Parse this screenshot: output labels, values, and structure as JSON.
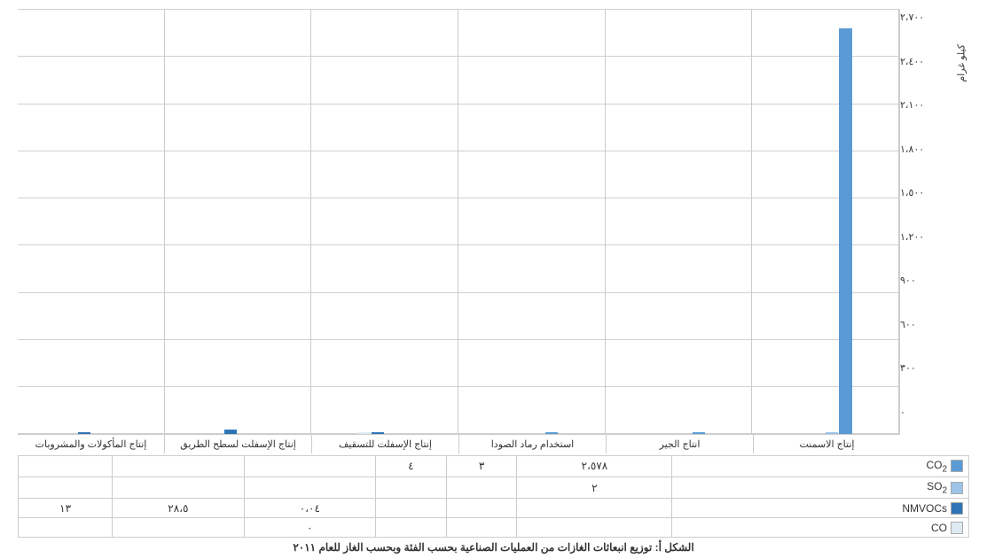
{
  "chart": {
    "title": "الشكل أ: توزيع انبعاثات الغازات من العملیات الصناعیة بحسب الفئة وبحسب الغاز للعام ٢٠١١",
    "y_axis_title": "كيلو غرام",
    "y_labels": [
      "٢،٧٠٠",
      "٢،٤٠٠",
      "٢،١٠٠",
      "١،٨٠٠",
      "١،٥٠٠",
      "١،٢٠٠",
      "٩٠٠",
      "٦٠٠",
      "٣٠٠",
      "٠"
    ],
    "y_max": 2700,
    "categories": [
      {
        "id": "cement",
        "label": "إنتاج الاسمنت"
      },
      {
        "id": "lime",
        "label": "انتاج الجیر"
      },
      {
        "id": "soda_ash",
        "label": "استخدام رماد الصودا"
      },
      {
        "id": "asphalt_roof",
        "label": "إنتاج الإسفلت للتسقیف"
      },
      {
        "id": "asphalt_road",
        "label": "إنتاج الإسفلت لسطح الطریق"
      },
      {
        "id": "food",
        "label": "إنتاج المأكولات والمشروبات"
      }
    ],
    "gases": [
      {
        "id": "co2",
        "label": "CO₂",
        "color": "#5b9bd5",
        "values": {
          "cement": 2578,
          "lime": 3,
          "soda_ash": 4,
          "asphalt_roof": 0,
          "asphalt_road": 0,
          "food": 0
        },
        "display_values": {
          "cement": "٢،٥٧٨",
          "lime": "٣",
          "soda_ash": "٤",
          "asphalt_roof": "",
          "asphalt_road": "",
          "food": ""
        }
      },
      {
        "id": "so2",
        "label": "SO₂",
        "color": "#9dc3e6",
        "values": {
          "cement": 2,
          "lime": 0,
          "soda_ash": 0,
          "asphalt_roof": 0,
          "asphalt_road": 0,
          "food": 0
        },
        "display_values": {
          "cement": "٢",
          "lime": "",
          "soda_ash": "",
          "asphalt_roof": "",
          "asphalt_road": "",
          "food": ""
        }
      },
      {
        "id": "nmvocs",
        "label": "NMVOCs",
        "color": "#2e75b6",
        "values": {
          "cement": 0,
          "lime": 0,
          "soda_ash": 0,
          "asphalt_roof": 0.04,
          "asphalt_road": 28.5,
          "food": 13
        },
        "display_values": {
          "cement": "",
          "lime": "",
          "soda_ash": "",
          "asphalt_roof": "٠،٠٤",
          "asphalt_road": "٢٨،٥",
          "food": "١٣"
        }
      },
      {
        "id": "co",
        "label": "CO",
        "color": "#deeaf1",
        "values": {
          "cement": 0,
          "lime": 0,
          "soda_ash": 0,
          "asphalt_roof": 0.001,
          "asphalt_road": 0,
          "food": 0
        },
        "display_values": {
          "cement": "",
          "lime": "",
          "soda_ash": "",
          "asphalt_roof": "٠",
          "asphalt_road": "",
          "food": ""
        }
      }
    ]
  }
}
